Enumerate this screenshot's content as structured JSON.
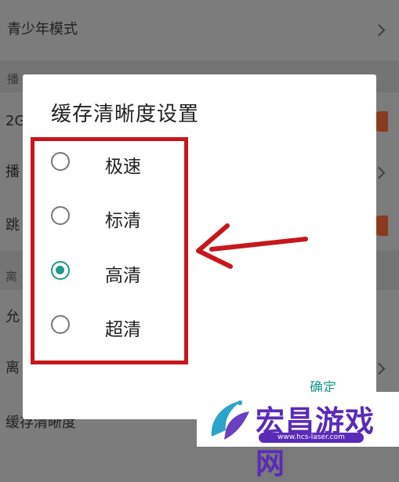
{
  "background": {
    "rows": [
      {
        "label": "青少年模式"
      },
      {
        "label": "播"
      },
      {
        "label": "2G"
      },
      {
        "label": "播"
      },
      {
        "label": "跳"
      },
      {
        "label": "离"
      },
      {
        "label": "允"
      },
      {
        "label": "离"
      },
      {
        "label": "缓存清晰度"
      }
    ]
  },
  "dialog": {
    "title": "缓存清晰度设置",
    "options": [
      {
        "label": "极速",
        "selected": false
      },
      {
        "label": "标清",
        "selected": false
      },
      {
        "label": "高清",
        "selected": true
      },
      {
        "label": "超清",
        "selected": false
      }
    ],
    "confirm_label": "确定"
  },
  "colors": {
    "accent": "#1b9a8a",
    "highlight": "#c8161d",
    "watermark": "#5a2bb8"
  },
  "watermark": {
    "text": "宏昌游戏网",
    "url": "www.hcs-laser.com"
  }
}
